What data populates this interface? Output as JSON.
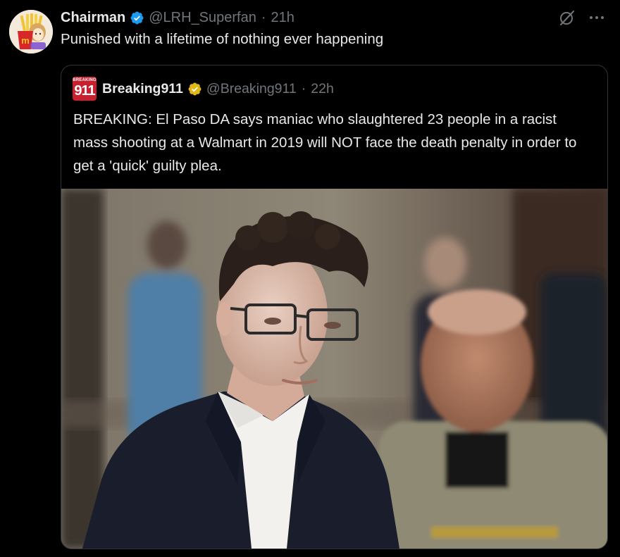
{
  "tweet": {
    "author_name": "Chairman",
    "author_handle": "@LRH_Superfan",
    "separator": "·",
    "time": "21h",
    "text": "Punished with a lifetime of nothing ever happening",
    "verified_icon": "verified-badge-icon",
    "avatar_icon": "fries-mascot-avatar"
  },
  "actions": {
    "grok_icon": "grok-icon",
    "more_icon": "more-icon",
    "more_glyph": "···"
  },
  "quoted_tweet": {
    "avatar_small_text": "BREAKING",
    "avatar_big_text": "911",
    "author_name": "Breaking911",
    "author_handle": "@Breaking911",
    "separator": "·",
    "time": "22h",
    "text": "BREAKING: El Paso DA says maniac who slaughtered 23 people in a racist mass shooting at a Walmart in 2019 will NOT face the death penalty in order to get a 'quick' guilty plea.",
    "badge_icon": "gold-verified-badge-icon",
    "media": "courtroom-photo"
  },
  "colors": {
    "background": "#000000",
    "text": "#e7e9ea",
    "muted": "#71767b",
    "border": "#2f3336",
    "verified_blue": "#1d9bf0",
    "gold": "#e2b719",
    "brand_red": "#c8202f"
  }
}
